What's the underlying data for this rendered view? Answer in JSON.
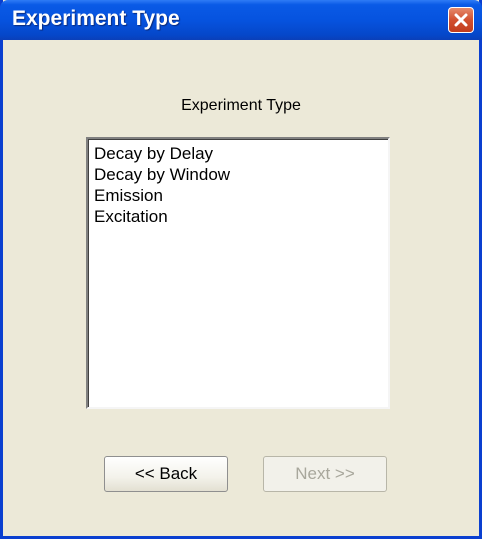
{
  "window": {
    "title": "Experiment Type",
    "close_icon": "close-icon"
  },
  "dialog": {
    "heading": "Experiment Type",
    "list": {
      "items": [
        {
          "label": "Decay by Delay"
        },
        {
          "label": "Decay by Window"
        },
        {
          "label": "Emission"
        },
        {
          "label": "Excitation"
        }
      ]
    },
    "buttons": {
      "back_label": "<< Back",
      "next_label": "Next >>",
      "next_enabled": false
    }
  },
  "colors": {
    "titlebar": "#0653df",
    "dialog_bg": "#ece9d8",
    "close_button": "#d2502f",
    "disabled_text": "#a8a79c"
  }
}
